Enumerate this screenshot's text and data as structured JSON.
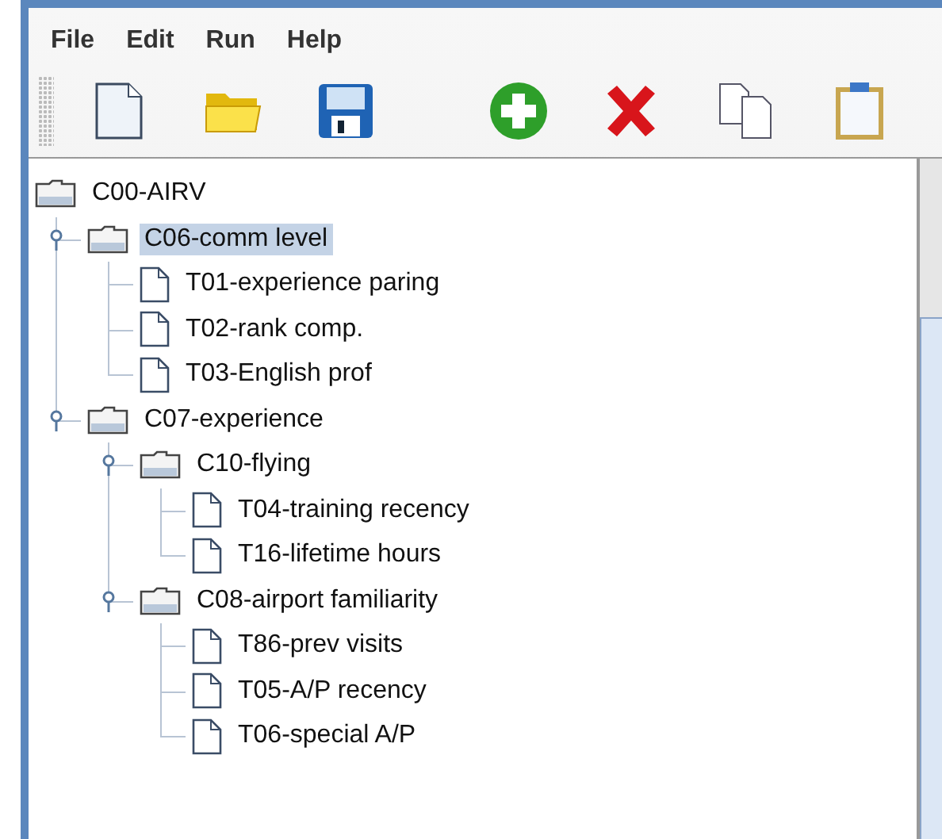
{
  "menu": [
    "File",
    "Edit",
    "Run",
    "Help"
  ],
  "tree": {
    "label": "C00-AIRV",
    "kind": "folder",
    "selected": false,
    "children": [
      {
        "label": "C06-comm level",
        "kind": "folder",
        "expanded": true,
        "selected": true,
        "children": [
          {
            "label": "T01-experience paring",
            "kind": "file",
            "selected": false
          },
          {
            "label": "T02-rank comp.",
            "kind": "file",
            "selected": false
          },
          {
            "label": "T03-English prof",
            "kind": "file",
            "selected": false
          }
        ]
      },
      {
        "label": "C07-experience",
        "kind": "folder",
        "expanded": true,
        "selected": false,
        "children": [
          {
            "label": "C10-flying",
            "kind": "folder",
            "expanded": true,
            "selected": false,
            "children": [
              {
                "label": "T04-training recency",
                "kind": "file",
                "selected": false
              },
              {
                "label": "T16-lifetime hours",
                "kind": "file",
                "selected": false
              }
            ]
          },
          {
            "label": "C08-airport familiarity",
            "kind": "folder",
            "expanded": true,
            "selected": false,
            "children": [
              {
                "label": "T86-prev visits",
                "kind": "file",
                "selected": false
              },
              {
                "label": "T05-A/P recency",
                "kind": "file",
                "selected": false
              },
              {
                "label": "T06-special A/P",
                "kind": "file",
                "selected": false
              }
            ]
          }
        ]
      }
    ]
  }
}
